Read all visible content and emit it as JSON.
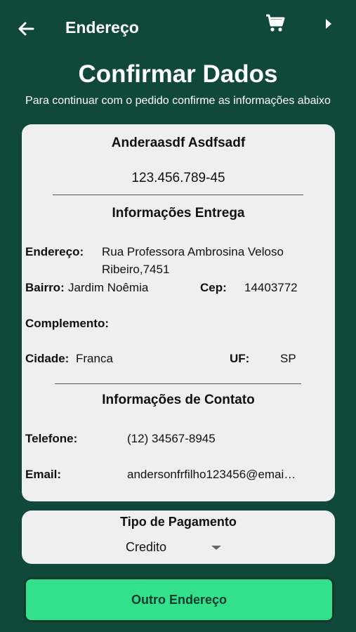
{
  "appbar": {
    "title": "Endereço",
    "back_icon": "arrow-left-icon",
    "cart_icon": "shopping-cart-icon",
    "more_icon": "chevron-right-icon"
  },
  "header": {
    "title": "Confirmar Dados",
    "subtitle": "Para continuar com o pedido confirme as informações abaixo"
  },
  "customer": {
    "name": "Anderaasdf Asdfsadf",
    "cpf": "123.456.789-45"
  },
  "delivery": {
    "section_title": "Informações Entrega",
    "address_label": "Endereço:",
    "address_line1": "Rua Professora Ambrosina Veloso",
    "address_line2": "Ribeiro,7451",
    "bairro_label": "Bairro:",
    "bairro_value": "Jardim Noêmia",
    "cep_label": "Cep:",
    "cep_value": "14403772",
    "complemento_label": "Complemento:",
    "cidade_label": "Cidade:",
    "cidade_value": "Franca",
    "uf_label": "UF:",
    "uf_value": "SP"
  },
  "contact": {
    "section_title": "Informações de Contato",
    "phone_label": "Telefone:",
    "phone_value": "(12) 34567-8945",
    "email_label": "Email:",
    "email_value": "andersonfrfilho123456@emai…"
  },
  "payment": {
    "title": "Tipo de Pagamento",
    "selected": "Credito"
  },
  "actions": {
    "other_address": "Outro Endereço"
  },
  "colors": {
    "background": "#10493a",
    "card": "#efefef",
    "button": "#33e08c"
  }
}
